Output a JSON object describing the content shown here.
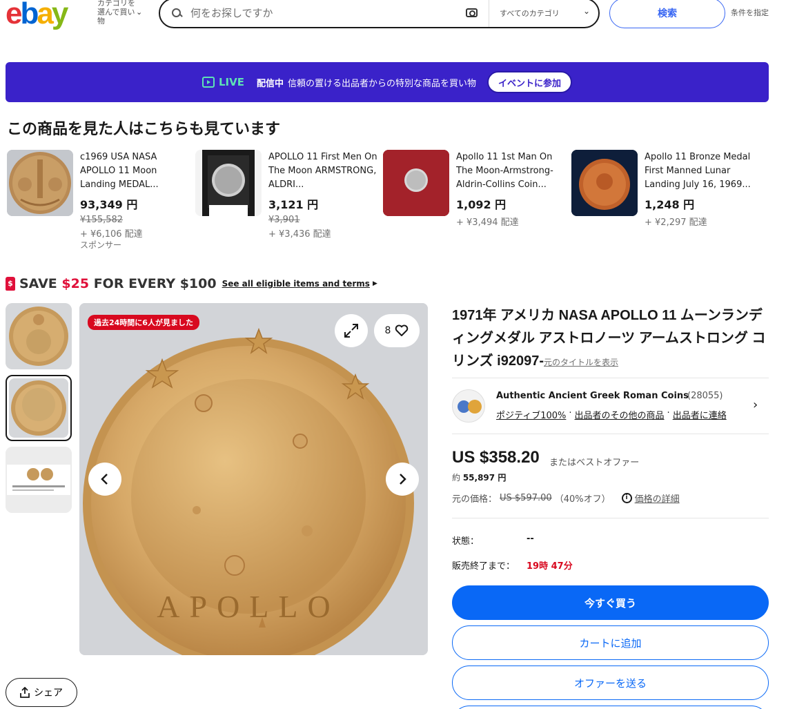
{
  "header": {
    "logo_letters": [
      "e",
      "b",
      "a",
      "y"
    ],
    "logo_colors": [
      "#e53238",
      "#0064d2",
      "#f5af02",
      "#86b817"
    ],
    "category_shop_label": "カテゴリを選んで買い物",
    "search_placeholder": "何をお探しですか",
    "category_select": "すべてのカテゴリ",
    "search_button": "検索",
    "advanced_label": "条件を指定"
  },
  "live_banner": {
    "live_label": "LIVE",
    "bold_text": "配信中",
    "text": "信頼の置ける出品者からの特別な商品を買い物",
    "button": "イベントに参加"
  },
  "also_viewed": {
    "title": "この商品を見た人はこちらも見ています",
    "items": [
      {
        "title": "c1969 USA NASA APOLLO 11 Moon Landing MEDAL...",
        "price": "93,349 円",
        "original_price": "¥155,582",
        "shipping": "+ ¥6,106 配達",
        "sponsored": "スポンサー"
      },
      {
        "title": "APOLLO 11 First Men On The Moon ARMSTRONG, ALDRI...",
        "price": "3,121 円",
        "original_price": "¥3,901",
        "shipping": "+ ¥3,436 配達",
        "sponsored": ""
      },
      {
        "title": "Apollo 11 1st Man On The Moon-Armstrong-Aldrin-Collins Coin...",
        "price": "1,092 円",
        "original_price": "",
        "shipping": "+ ¥3,494 配達",
        "sponsored": ""
      },
      {
        "title": "Apollo 11 Bronze Medal First Manned Lunar Landing July 16, 1969...",
        "price": "1,248 円",
        "original_price": "",
        "shipping": "+ ¥2,297 配達",
        "sponsored": ""
      }
    ]
  },
  "save_banner": {
    "tag": "$",
    "prefix": "SAVE ",
    "amount": "$25",
    "suffix": " FOR EVERY $100",
    "link": "See all eligible items and terms"
  },
  "gallery": {
    "viewed_badge": "過去24時間に6人が見ました",
    "watch_count": "8",
    "coin_text": "APOLLO"
  },
  "share_button": "シェア",
  "item": {
    "title": "1971年 アメリカ NASA APOLLO 11 ムーンランディングメダル アストロノーツ アームストロング コリンズ i92097-",
    "original_title_link": "元のタイトルを表示",
    "seller": {
      "name": "Authentic Ancient Greek Roman Coins",
      "feedback_count": "(28055)",
      "positive": "ポジティブ100%",
      "other_items": "出品者のその他の商品",
      "contact": "出品者に連絡"
    },
    "price": "US $358.20",
    "best_offer": "またはベストオファー",
    "approx_prefix": "約 ",
    "approx_value": "55,897 円",
    "was_label": "元の価格：",
    "was_price": "US $597.00",
    "discount": "（40%オフ）",
    "price_details": "価格の詳細",
    "condition_label": "状態：",
    "condition_value": "--",
    "ends_label": "販売終了まで：",
    "ends_value": "19時 47分",
    "buy_now": "今すぐ買う",
    "add_to_cart": "カートに追加",
    "make_offer": "オファーを送る"
  }
}
